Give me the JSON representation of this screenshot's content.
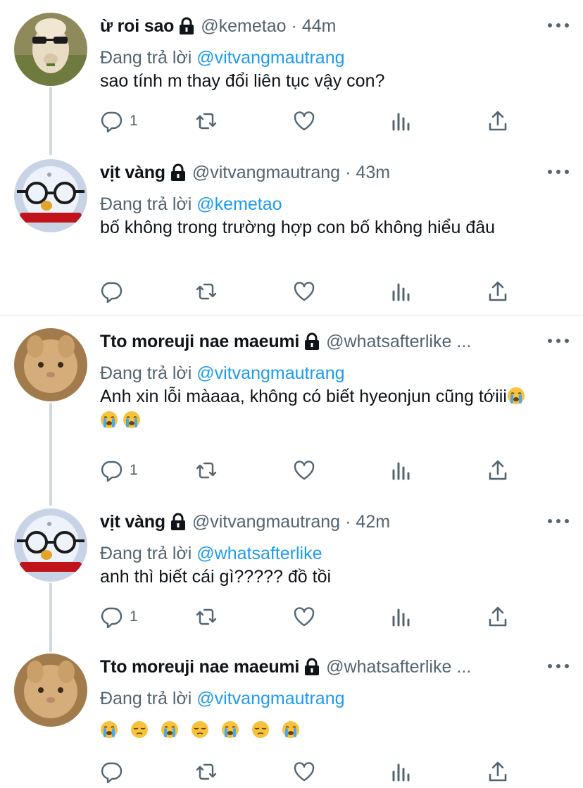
{
  "reply_prefix": "Đang trả lời",
  "tweets": [
    {
      "name": "ừ roi sao",
      "handle": "@kemetao",
      "sep": "·",
      "time": "44m",
      "reply_to": "@vitvangmautrang",
      "text": "sao tính m thay đổi liên tục vậy con?",
      "reply_count": "1"
    },
    {
      "name": "vịt vàng",
      "handle": "@vitvangmautrang",
      "sep": "·",
      "time": "43m",
      "reply_to": "@kemetao",
      "text": "bố không trong trường hợp con bố không hiểu đâu",
      "reply_count": ""
    },
    {
      "name": "Tto moreuji nae maeumi",
      "handle": "@whatsafterlike",
      "sep": "...",
      "time": "",
      "reply_to": "@vitvangmautrang",
      "text": "Anh xin lỗi màaaa, không có biết hyeonjun cũng tớiii",
      "reply_count": "1"
    },
    {
      "name": "vịt vàng",
      "handle": "@vitvangmautrang",
      "sep": "·",
      "time": "42m",
      "reply_to": "@whatsafterlike",
      "text": "anh thì biết cái gì????? đồ tồi",
      "reply_count": "1"
    },
    {
      "name": "Tto moreuji nae maeumi",
      "handle": "@whatsafterlike",
      "sep": "...",
      "time": "",
      "reply_to": "@vitvangmautrang",
      "text": "",
      "reply_count": ""
    }
  ],
  "icons": {
    "reply": "reply-icon",
    "retweet": "retweet-icon",
    "like": "heart-icon",
    "stats": "analytics-icon",
    "share": "share-icon",
    "lock": "lock-icon",
    "more": "more-icon"
  },
  "colors": {
    "link": "#1d9bf0",
    "muted": "#536471",
    "text": "#0f1419"
  }
}
